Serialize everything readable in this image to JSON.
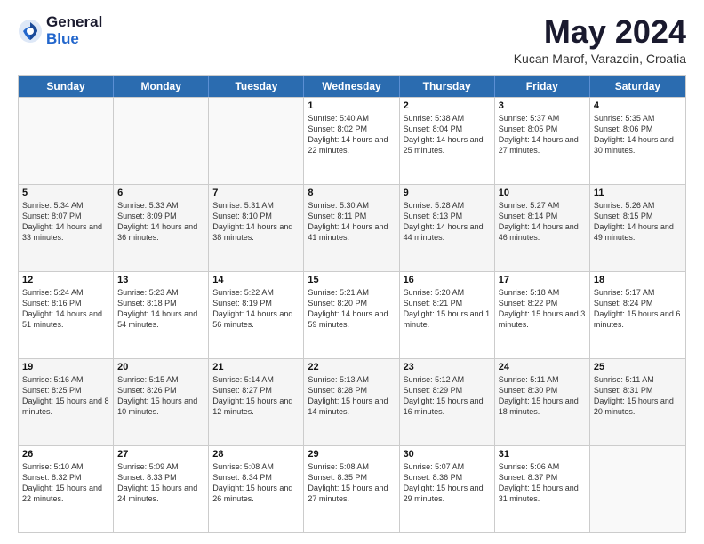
{
  "logo": {
    "general": "General",
    "blue": "Blue"
  },
  "title": "May 2024",
  "location": "Kucan Marof, Varazdin, Croatia",
  "days": [
    "Sunday",
    "Monday",
    "Tuesday",
    "Wednesday",
    "Thursday",
    "Friday",
    "Saturday"
  ],
  "weeks": [
    {
      "alt": false,
      "cells": [
        {
          "day": "",
          "sunrise": "",
          "sunset": "",
          "daylight": ""
        },
        {
          "day": "",
          "sunrise": "",
          "sunset": "",
          "daylight": ""
        },
        {
          "day": "",
          "sunrise": "",
          "sunset": "",
          "daylight": ""
        },
        {
          "day": "1",
          "sunrise": "Sunrise: 5:40 AM",
          "sunset": "Sunset: 8:02 PM",
          "daylight": "Daylight: 14 hours and 22 minutes."
        },
        {
          "day": "2",
          "sunrise": "Sunrise: 5:38 AM",
          "sunset": "Sunset: 8:04 PM",
          "daylight": "Daylight: 14 hours and 25 minutes."
        },
        {
          "day": "3",
          "sunrise": "Sunrise: 5:37 AM",
          "sunset": "Sunset: 8:05 PM",
          "daylight": "Daylight: 14 hours and 27 minutes."
        },
        {
          "day": "4",
          "sunrise": "Sunrise: 5:35 AM",
          "sunset": "Sunset: 8:06 PM",
          "daylight": "Daylight: 14 hours and 30 minutes."
        }
      ]
    },
    {
      "alt": true,
      "cells": [
        {
          "day": "5",
          "sunrise": "Sunrise: 5:34 AM",
          "sunset": "Sunset: 8:07 PM",
          "daylight": "Daylight: 14 hours and 33 minutes."
        },
        {
          "day": "6",
          "sunrise": "Sunrise: 5:33 AM",
          "sunset": "Sunset: 8:09 PM",
          "daylight": "Daylight: 14 hours and 36 minutes."
        },
        {
          "day": "7",
          "sunrise": "Sunrise: 5:31 AM",
          "sunset": "Sunset: 8:10 PM",
          "daylight": "Daylight: 14 hours and 38 minutes."
        },
        {
          "day": "8",
          "sunrise": "Sunrise: 5:30 AM",
          "sunset": "Sunset: 8:11 PM",
          "daylight": "Daylight: 14 hours and 41 minutes."
        },
        {
          "day": "9",
          "sunrise": "Sunrise: 5:28 AM",
          "sunset": "Sunset: 8:13 PM",
          "daylight": "Daylight: 14 hours and 44 minutes."
        },
        {
          "day": "10",
          "sunrise": "Sunrise: 5:27 AM",
          "sunset": "Sunset: 8:14 PM",
          "daylight": "Daylight: 14 hours and 46 minutes."
        },
        {
          "day": "11",
          "sunrise": "Sunrise: 5:26 AM",
          "sunset": "Sunset: 8:15 PM",
          "daylight": "Daylight: 14 hours and 49 minutes."
        }
      ]
    },
    {
      "alt": false,
      "cells": [
        {
          "day": "12",
          "sunrise": "Sunrise: 5:24 AM",
          "sunset": "Sunset: 8:16 PM",
          "daylight": "Daylight: 14 hours and 51 minutes."
        },
        {
          "day": "13",
          "sunrise": "Sunrise: 5:23 AM",
          "sunset": "Sunset: 8:18 PM",
          "daylight": "Daylight: 14 hours and 54 minutes."
        },
        {
          "day": "14",
          "sunrise": "Sunrise: 5:22 AM",
          "sunset": "Sunset: 8:19 PM",
          "daylight": "Daylight: 14 hours and 56 minutes."
        },
        {
          "day": "15",
          "sunrise": "Sunrise: 5:21 AM",
          "sunset": "Sunset: 8:20 PM",
          "daylight": "Daylight: 14 hours and 59 minutes."
        },
        {
          "day": "16",
          "sunrise": "Sunrise: 5:20 AM",
          "sunset": "Sunset: 8:21 PM",
          "daylight": "Daylight: 15 hours and 1 minute."
        },
        {
          "day": "17",
          "sunrise": "Sunrise: 5:18 AM",
          "sunset": "Sunset: 8:22 PM",
          "daylight": "Daylight: 15 hours and 3 minutes."
        },
        {
          "day": "18",
          "sunrise": "Sunrise: 5:17 AM",
          "sunset": "Sunset: 8:24 PM",
          "daylight": "Daylight: 15 hours and 6 minutes."
        }
      ]
    },
    {
      "alt": true,
      "cells": [
        {
          "day": "19",
          "sunrise": "Sunrise: 5:16 AM",
          "sunset": "Sunset: 8:25 PM",
          "daylight": "Daylight: 15 hours and 8 minutes."
        },
        {
          "day": "20",
          "sunrise": "Sunrise: 5:15 AM",
          "sunset": "Sunset: 8:26 PM",
          "daylight": "Daylight: 15 hours and 10 minutes."
        },
        {
          "day": "21",
          "sunrise": "Sunrise: 5:14 AM",
          "sunset": "Sunset: 8:27 PM",
          "daylight": "Daylight: 15 hours and 12 minutes."
        },
        {
          "day": "22",
          "sunrise": "Sunrise: 5:13 AM",
          "sunset": "Sunset: 8:28 PM",
          "daylight": "Daylight: 15 hours and 14 minutes."
        },
        {
          "day": "23",
          "sunrise": "Sunrise: 5:12 AM",
          "sunset": "Sunset: 8:29 PM",
          "daylight": "Daylight: 15 hours and 16 minutes."
        },
        {
          "day": "24",
          "sunrise": "Sunrise: 5:11 AM",
          "sunset": "Sunset: 8:30 PM",
          "daylight": "Daylight: 15 hours and 18 minutes."
        },
        {
          "day": "25",
          "sunrise": "Sunrise: 5:11 AM",
          "sunset": "Sunset: 8:31 PM",
          "daylight": "Daylight: 15 hours and 20 minutes."
        }
      ]
    },
    {
      "alt": false,
      "cells": [
        {
          "day": "26",
          "sunrise": "Sunrise: 5:10 AM",
          "sunset": "Sunset: 8:32 PM",
          "daylight": "Daylight: 15 hours and 22 minutes."
        },
        {
          "day": "27",
          "sunrise": "Sunrise: 5:09 AM",
          "sunset": "Sunset: 8:33 PM",
          "daylight": "Daylight: 15 hours and 24 minutes."
        },
        {
          "day": "28",
          "sunrise": "Sunrise: 5:08 AM",
          "sunset": "Sunset: 8:34 PM",
          "daylight": "Daylight: 15 hours and 26 minutes."
        },
        {
          "day": "29",
          "sunrise": "Sunrise: 5:08 AM",
          "sunset": "Sunset: 8:35 PM",
          "daylight": "Daylight: 15 hours and 27 minutes."
        },
        {
          "day": "30",
          "sunrise": "Sunrise: 5:07 AM",
          "sunset": "Sunset: 8:36 PM",
          "daylight": "Daylight: 15 hours and 29 minutes."
        },
        {
          "day": "31",
          "sunrise": "Sunrise: 5:06 AM",
          "sunset": "Sunset: 8:37 PM",
          "daylight": "Daylight: 15 hours and 31 minutes."
        },
        {
          "day": "",
          "sunrise": "",
          "sunset": "",
          "daylight": ""
        }
      ]
    }
  ]
}
